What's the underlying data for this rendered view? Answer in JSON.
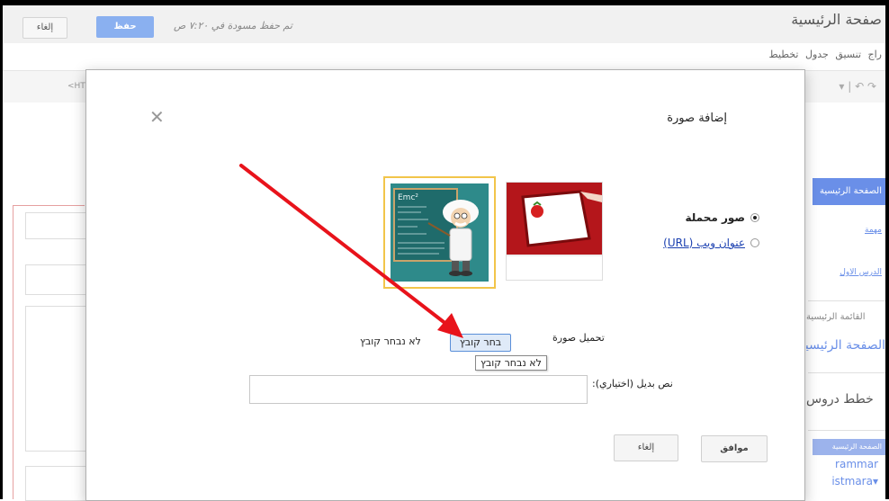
{
  "editor": {
    "cancel_label": "إلغاء",
    "save_label": "حفظ",
    "draft_status": "تم حفظ مسودة في ٧:٢٠ ص",
    "page_title": "صفحة الرئيسية",
    "menu": "راج  تنسيق  جدول  تخطيط",
    "html_tab": "<HT",
    "toolbar_right": "▾ | ↶ ↷"
  },
  "sidebar": {
    "home_button": "الصفحة الرئيسية",
    "link_important": "مهمة",
    "link_first_lesson": "الدرس الاول",
    "main_menu_label": "القائمة الرئيسية",
    "home_big_link": "الصفحة الرئيسية",
    "lesson_plans": "خطط دروس",
    "bottom_bar": "الصفحة الرئيسية",
    "english_1": "rammar",
    "english_2": "istmara▾"
  },
  "dialog": {
    "title": "إضافة صورة",
    "close_glyph": "✕",
    "option_uploaded": "صور محملة",
    "option_url": "عنوان ويب (URL)",
    "upload_label": "تحميل صورة",
    "choose_file": "בחר קובץ",
    "no_file": "לא נבחר קובץ",
    "tooltip": "לא נבחר קובץ",
    "alt_label": "نص بديل (اختياري):",
    "ok_label": "موافق",
    "cancel_label": "إلغاء",
    "thumb_word": "Emc²"
  },
  "colors": {
    "accent_blue": "#6a8fe8",
    "selection_border": "#f2c54a",
    "arrow_red": "#e8131b"
  }
}
